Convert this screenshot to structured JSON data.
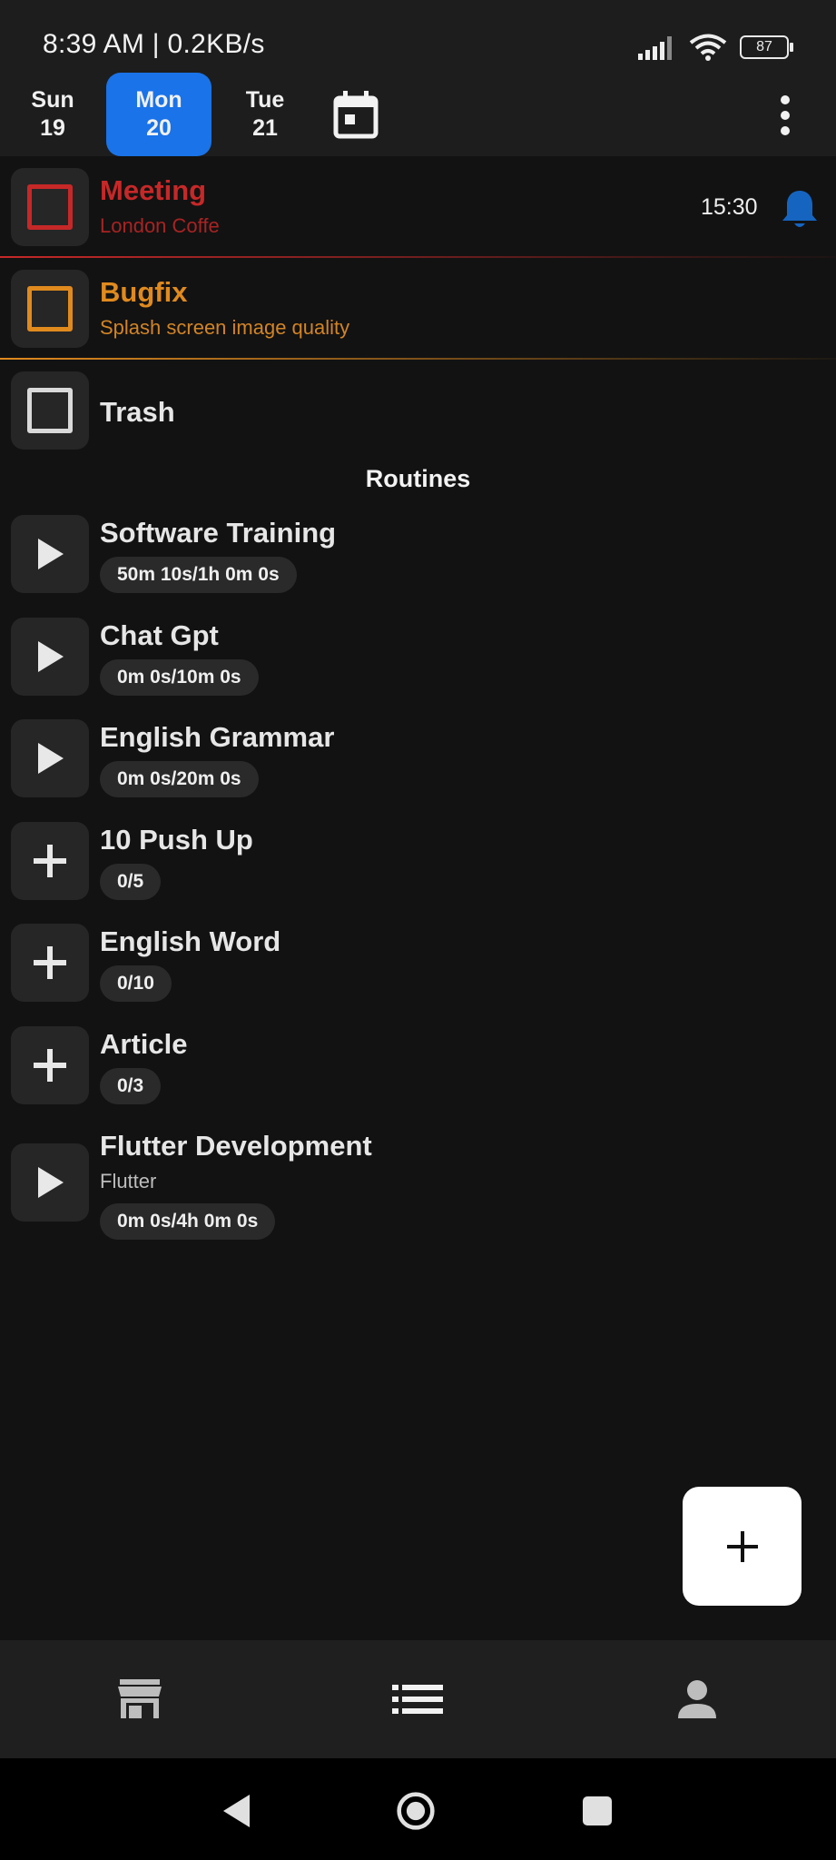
{
  "status": {
    "time": "8:39 AM | 0.2KB/s",
    "battery": "87"
  },
  "days": [
    {
      "dow": "Sun",
      "num": "19"
    },
    {
      "dow": "Mon",
      "num": "20"
    },
    {
      "dow": "Tue",
      "num": "21"
    }
  ],
  "tasks": [
    {
      "title": "Meeting",
      "subtitle": "London Coffe",
      "time": "15:30",
      "color": "#c62828"
    },
    {
      "title": "Bugfix",
      "subtitle": "Splash screen image quality",
      "color": "#e08a1e"
    },
    {
      "title": "Trash",
      "color": "#d9d9d9"
    }
  ],
  "routines_title": "Routines",
  "routines": [
    {
      "title": "Software Training",
      "progress": "50m 10s/1h 0m 0s",
      "icon": "play-icon"
    },
    {
      "title": "Chat Gpt",
      "progress": "0m 0s/10m 0s",
      "icon": "play-icon"
    },
    {
      "title": "English Grammar",
      "progress": "0m 0s/20m 0s",
      "icon": "play-icon"
    },
    {
      "title": "10 Push Up",
      "progress": "0/5",
      "icon": "plus-icon"
    },
    {
      "title": "English Word",
      "progress": "0/10",
      "icon": "plus-icon"
    },
    {
      "title": "Article",
      "progress": "0/3",
      "icon": "plus-icon"
    },
    {
      "title": "Flutter Development",
      "subtitle": "Flutter",
      "progress": "0m 0s/4h 0m 0s",
      "icon": "play-icon"
    }
  ],
  "colors": {
    "accent": "#1a73e8",
    "bell": "#1565c0"
  }
}
